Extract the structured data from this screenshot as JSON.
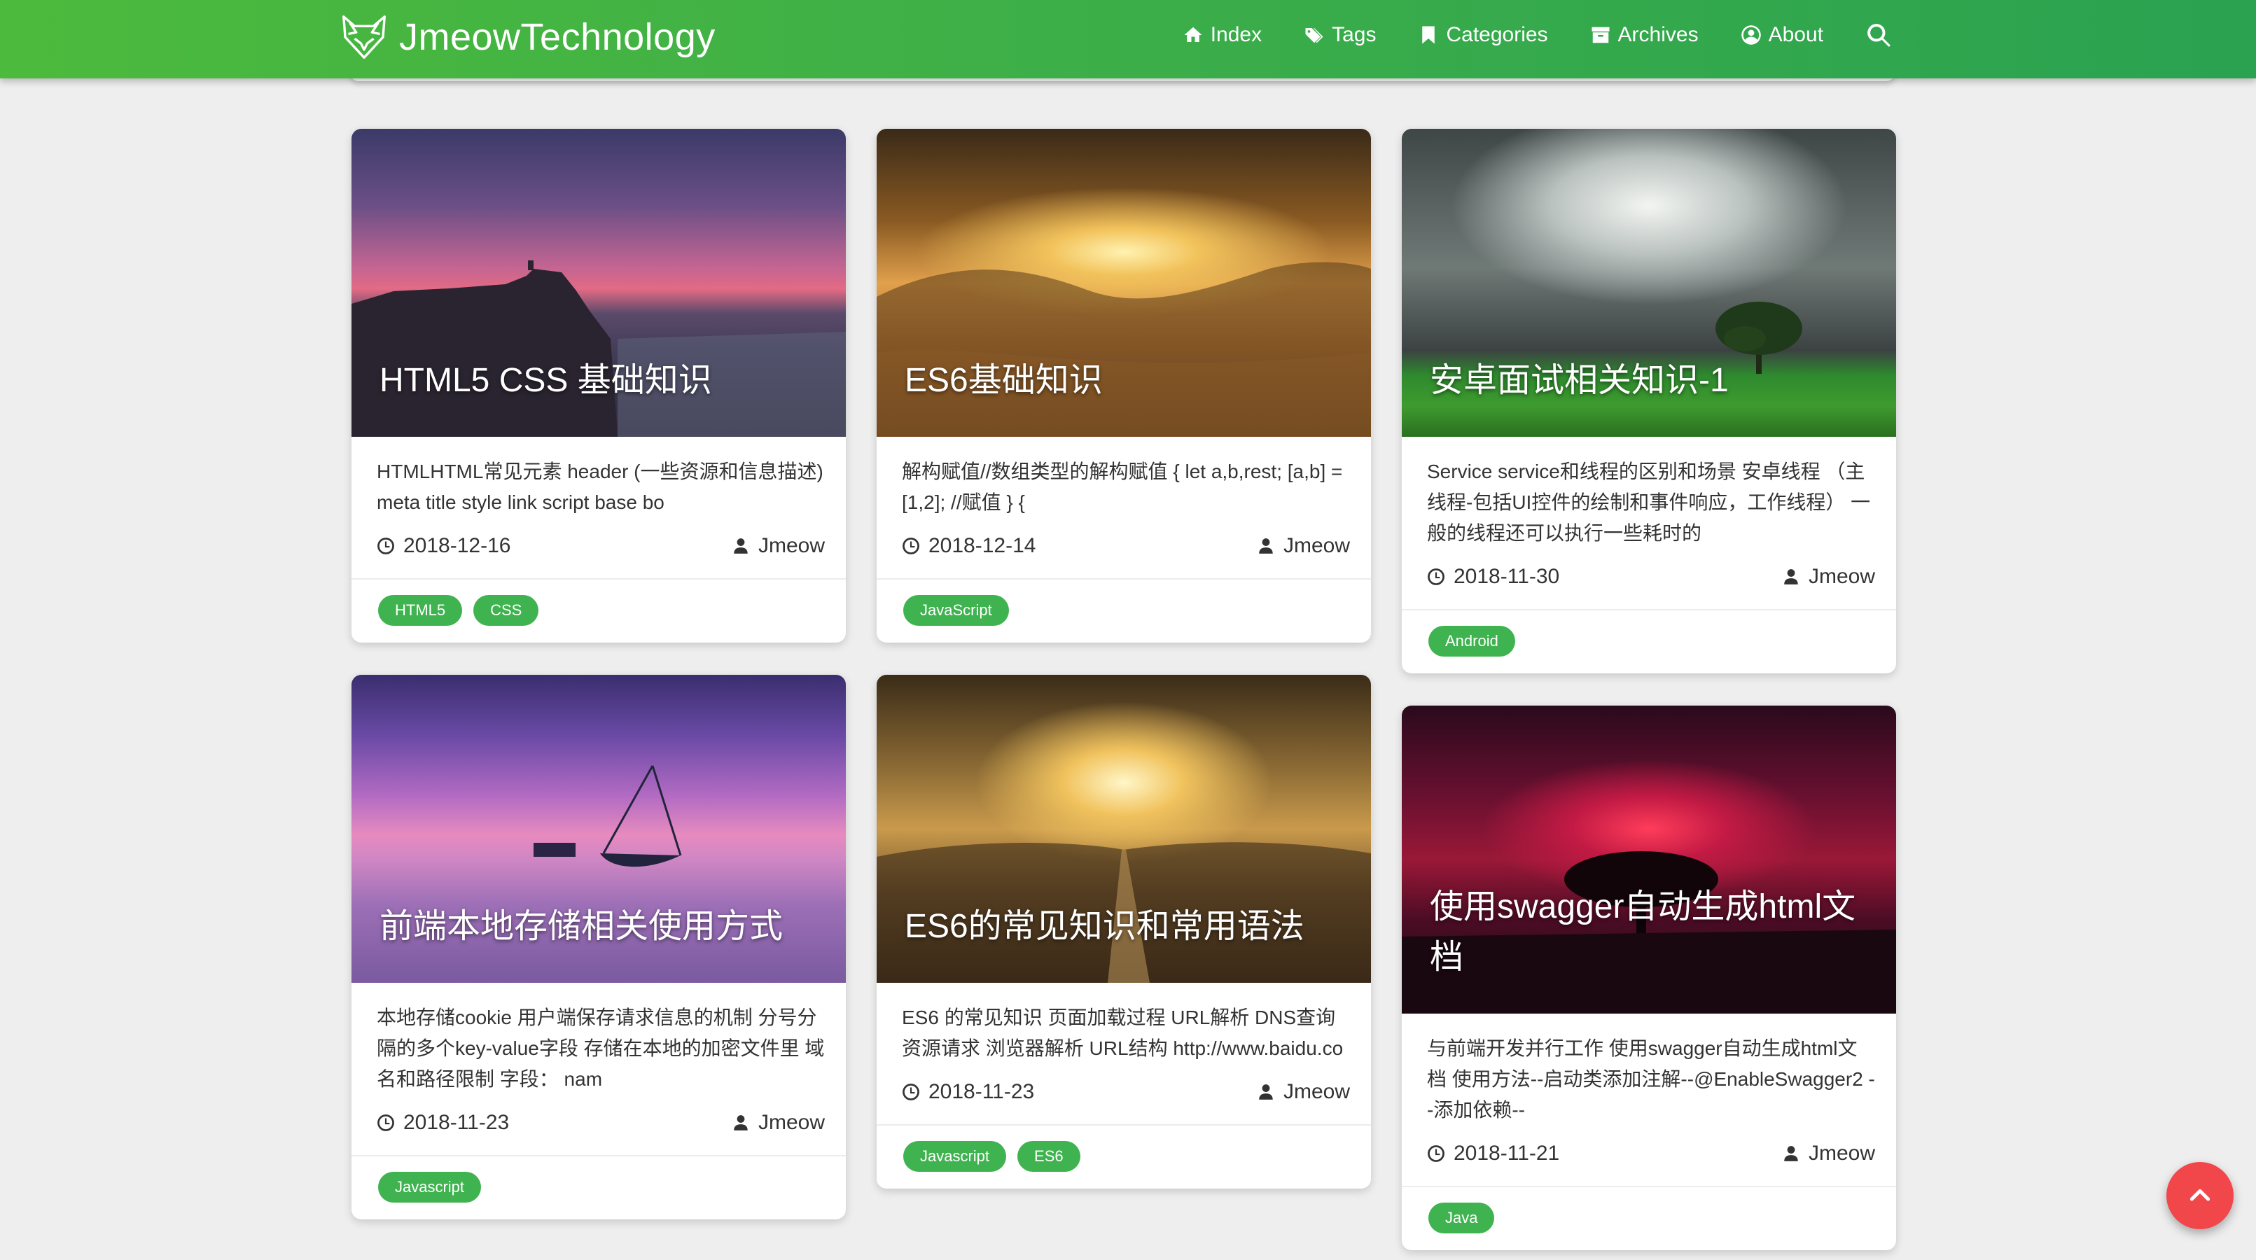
{
  "header": {
    "brand": "JmeowTechnology",
    "nav": [
      {
        "label": "Index",
        "icon": "home-icon"
      },
      {
        "label": "Tags",
        "icon": "tags-icon"
      },
      {
        "label": "Categories",
        "icon": "bookmark-icon"
      },
      {
        "label": "Archives",
        "icon": "archive-icon"
      },
      {
        "label": "About",
        "icon": "user-circle-icon"
      }
    ]
  },
  "posts": [
    {
      "title": "HTML5 CSS 基础知识",
      "excerpt": "HTMLHTML常见元素 header (一些资源和信息描述) meta title style link script base bo",
      "date": "2018-12-16",
      "author": "Jmeow",
      "tags": [
        "HTML5",
        "CSS"
      ]
    },
    {
      "title": "ES6基础知识",
      "excerpt": "解构赋值//数组类型的解构赋值 { let a,b,rest; [a,b] = [1,2]; //赋值 } {",
      "date": "2018-12-14",
      "author": "Jmeow",
      "tags": [
        "JavaScript"
      ]
    },
    {
      "title": "安卓面试相关知识-1",
      "excerpt": "Service service和线程的区别和场景 安卓线程 （主线程-包括UI控件的绘制和事件响应，工作线程） 一般的线程还可以执行一些耗时的",
      "date": "2018-11-30",
      "author": "Jmeow",
      "tags": [
        "Android"
      ]
    },
    {
      "title": "前端本地存储相关使用方式",
      "excerpt": "本地存储cookie 用户端保存请求信息的机制 分号分隔的多个key-value字段 存储在本地的加密文件里 域名和路径限制 字段： nam",
      "date": "2018-11-23",
      "author": "Jmeow",
      "tags": [
        "Javascript"
      ]
    },
    {
      "title": "ES6的常见知识和常用语法",
      "excerpt": "ES6 的常见知识 页面加载过程 URL解析 DNS查询 资源请求 浏览器解析 URL结构 http://www.baidu.co",
      "date": "2018-11-23",
      "author": "Jmeow",
      "tags": [
        "Javascript",
        "ES6"
      ]
    },
    {
      "title": "使用swagger自动生成html文档",
      "excerpt": "与前端开发并行工作 使用swagger自动生成html文档 使用方法--启动类添加注解--@EnableSwagger2 --添加依赖--",
      "date": "2018-11-21",
      "author": "Jmeow",
      "tags": [
        "Java"
      ]
    }
  ]
}
